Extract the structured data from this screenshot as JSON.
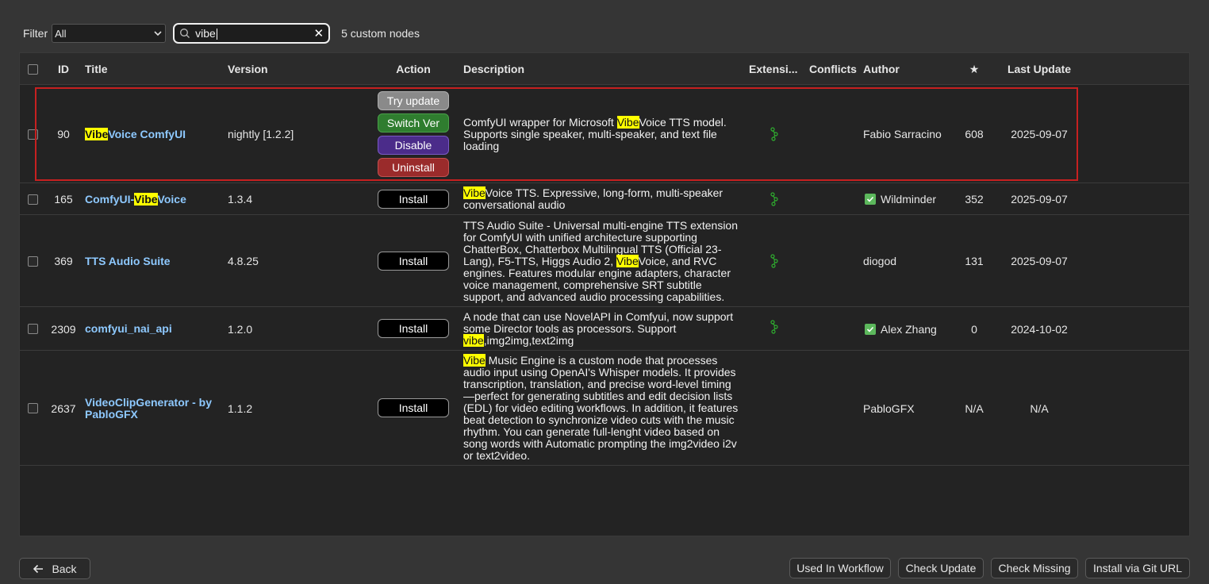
{
  "toolbar": {
    "filter_label": "Filter",
    "filter_value": "All",
    "search_value": "vibe",
    "count_text": "5 custom nodes"
  },
  "table": {
    "headers": {
      "id": "ID",
      "title": "Title",
      "version": "Version",
      "action": "Action",
      "description": "Description",
      "extensions": "Extensi...",
      "conflicts": "Conflicts",
      "author": "Author",
      "stars": "★",
      "last_update": "Last Update"
    },
    "rows": [
      {
        "id": "90",
        "title_pre": "",
        "title_hl": "Vibe",
        "title_post": "Voice ComfyUI",
        "version": "nightly [1.2.2]",
        "actions": [
          "Try update",
          "Switch Ver",
          "Disable",
          "Uninstall"
        ],
        "desc_line1_pre": "ComfyUI wrapper for Microsoft ",
        "desc_line1_hl": "Vibe",
        "desc_line1_post": "Voice TTS model.",
        "desc_rest": "Supports single speaker, multi-speaker, and text file loading",
        "author": "Fabio Sarracino",
        "author_verified": false,
        "stars": "608",
        "last_update": "2025-09-07"
      },
      {
        "id": "165",
        "title_pre": "ComfyUI-",
        "title_hl": "Vibe",
        "title_post": "Voice",
        "version": "1.3.4",
        "install_label": "Install",
        "desc_hl": "Vibe",
        "desc_post": "Voice TTS. Expressive, long-form, multi-speaker conversational audio",
        "author": "Wildminder",
        "author_verified": true,
        "stars": "352",
        "last_update": "2025-09-07"
      },
      {
        "id": "369",
        "title": "TTS Audio Suite",
        "version": "4.8.25",
        "install_label": "Install",
        "desc_pre": "TTS Audio Suite - Universal multi-engine TTS extension for ComfyUI with unified architecture supporting ChatterBox, Chatterbox Multilingual TTS (Official 23-Lang), F5-TTS, Higgs Audio 2, ",
        "desc_hl": "Vibe",
        "desc_post": "Voice, and RVC engines. Features modular engine adapters, character voice management, comprehensive SRT subtitle support, and advanced audio processing capabilities.",
        "author": "diogod",
        "author_verified": false,
        "stars": "131",
        "last_update": "2025-09-07"
      },
      {
        "id": "2309",
        "title": "comfyui_nai_api",
        "version": "1.2.0",
        "install_label": "Install",
        "desc_pre": "A node that can use NovelAPI in Comfyui, now support some Director tools as processors. Support ",
        "desc_hl": "vibe",
        "desc_post": ",img2img,text2img",
        "author": "Alex Zhang",
        "author_verified": true,
        "stars": "0",
        "last_update": "2024-10-02"
      },
      {
        "id": "2637",
        "title": "VideoClipGenerator - by PabloGFX",
        "version": "1.1.2",
        "install_label": "Install",
        "desc_hl": "Vibe",
        "desc_post": " Music Engine is a custom node that processes audio input using OpenAI's Whisper models. It provides transcription, translation, and precise word-level timing—perfect for generating subtitles and edit decision lists (EDL) for video editing workflows. In addition, it features beat detection to synchronize video cuts with the music rhythm. You can generate full-lenght video based on song words with Automatic prompting the img2video i2v or text2video.",
        "author": "PabloGFX",
        "author_verified": false,
        "stars": "N/A",
        "last_update": "N/A"
      }
    ]
  },
  "footer": {
    "back_label": "Back",
    "used_in_workflow": "Used In Workflow",
    "check_update": "Check Update",
    "check_missing": "Check Missing",
    "install_git": "Install via Git URL"
  },
  "colors": {
    "highlight": "#ffff00",
    "title_link": "#8ec9ff",
    "selected_outline": "#c62020"
  }
}
